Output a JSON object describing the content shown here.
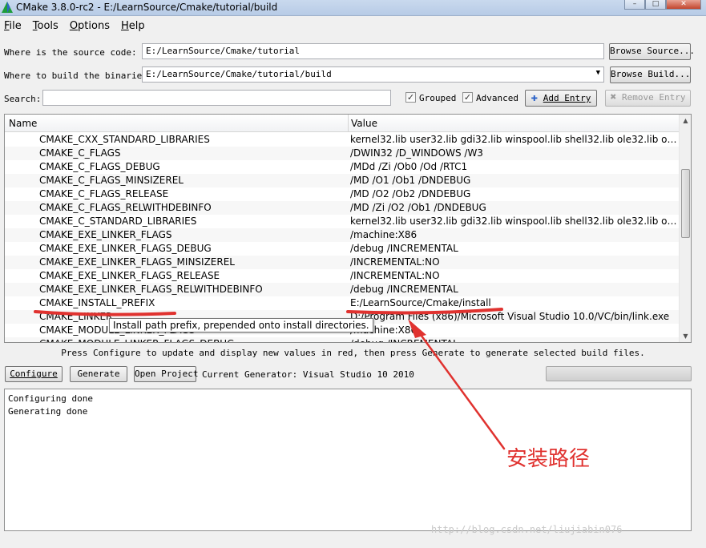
{
  "window": {
    "title": "CMake 3.8.0-rc2 - E:/LearnSource/Cmake/tutorial/build"
  },
  "menu": [
    {
      "key": "F",
      "rest": "ile"
    },
    {
      "key": "T",
      "rest": "ools"
    },
    {
      "key": "O",
      "rest": "ptions"
    },
    {
      "key": "H",
      "rest": "elp"
    }
  ],
  "source": {
    "label": "Where is the source code:",
    "value": "E:/LearnSource/Cmake/tutorial",
    "browse_label": "Browse Source..."
  },
  "binaries": {
    "label": "Where to build the binaries:",
    "value": "E:/LearnSource/Cmake/tutorial/build",
    "browse_label": "Browse Build..."
  },
  "search": {
    "label": "Search:",
    "value": ""
  },
  "options": {
    "grouped_label": "Grouped",
    "grouped_checked": true,
    "advanced_label": "Advanced",
    "advanced_checked": true,
    "add_entry_label": "Add Entry",
    "remove_entry_label": "Remove Entry"
  },
  "table": {
    "columns": [
      "Name",
      "Value"
    ],
    "rows": [
      {
        "name": "CMAKE_CXX_STANDARD_LIBRARIES",
        "value": "kernel32.lib user32.lib gdi32.lib winspool.lib shell32.lib ole32.lib ole..."
      },
      {
        "name": "CMAKE_C_FLAGS",
        "value": "/DWIN32 /D_WINDOWS /W3"
      },
      {
        "name": "CMAKE_C_FLAGS_DEBUG",
        "value": "/MDd /Zi /Ob0 /Od /RTC1"
      },
      {
        "name": "CMAKE_C_FLAGS_MINSIZEREL",
        "value": "/MD /O1 /Ob1 /DNDEBUG"
      },
      {
        "name": "CMAKE_C_FLAGS_RELEASE",
        "value": "/MD /O2 /Ob2 /DNDEBUG"
      },
      {
        "name": "CMAKE_C_FLAGS_RELWITHDEBINFO",
        "value": "/MD /Zi /O2 /Ob1 /DNDEBUG"
      },
      {
        "name": "CMAKE_C_STANDARD_LIBRARIES",
        "value": "kernel32.lib user32.lib gdi32.lib winspool.lib shell32.lib ole32.lib ole..."
      },
      {
        "name": "CMAKE_EXE_LINKER_FLAGS",
        "value": "/machine:X86"
      },
      {
        "name": "CMAKE_EXE_LINKER_FLAGS_DEBUG",
        "value": "/debug /INCREMENTAL"
      },
      {
        "name": "CMAKE_EXE_LINKER_FLAGS_MINSIZEREL",
        "value": "/INCREMENTAL:NO"
      },
      {
        "name": "CMAKE_EXE_LINKER_FLAGS_RELEASE",
        "value": "/INCREMENTAL:NO"
      },
      {
        "name": "CMAKE_EXE_LINKER_FLAGS_RELWITHDEBINFO",
        "value": "/debug /INCREMENTAL"
      },
      {
        "name": "CMAKE_INSTALL_PREFIX",
        "value": "E:/LearnSource/Cmake/install"
      },
      {
        "name": "CMAKE_LINKER",
        "value": "D:/Program Files (x86)/Microsoft Visual Studio 10.0/VC/bin/link.exe"
      },
      {
        "name": "CMAKE_MODULE_LINKER_FLAGS",
        "value": "/machine:X86"
      },
      {
        "name": "CMAKE_MODULE_LINKER_FLAGS_DEBUG",
        "value": "/debug /INCREMENTAL"
      }
    ]
  },
  "tooltip": "Install path prefix, prepended onto install directories.",
  "hint": "Press Configure to update and display new values in red, then press Generate to generate selected build files.",
  "actions": {
    "configure_label": "Configure",
    "generate_label": "Generate",
    "open_project_label": "Open Project",
    "generator_text": "Current Generator: Visual Studio 10 2010"
  },
  "output": [
    "Configuring done",
    "Generating done"
  ],
  "annotation": {
    "text": "安装路径",
    "color": "#e0322f"
  },
  "watermark": "http://blog.csdn.net/liujiabin076"
}
